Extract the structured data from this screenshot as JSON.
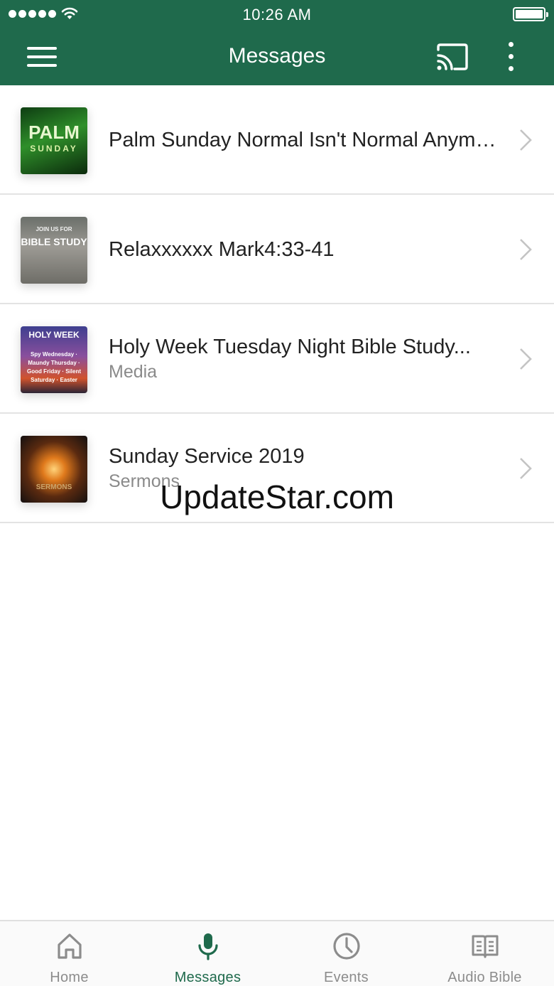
{
  "status_bar": {
    "time": "10:26 AM"
  },
  "header": {
    "title": "Messages"
  },
  "messages": [
    {
      "title": "Palm Sunday Normal Isn't Normal Anymore",
      "subtitle": "",
      "thumb_text": "PALM",
      "thumb_sub": "SUNDAY"
    },
    {
      "title": "Relaxxxxxx  Mark4:33-41",
      "subtitle": "",
      "thumb_text": "BIBLE STUDY",
      "thumb_sub": "JOIN US FOR"
    },
    {
      "title": "Holy Week Tuesday Night Bible Study...",
      "subtitle": "Media",
      "thumb_text": "HOLY WEEK",
      "thumb_sub": "Spy Wednesday · Maundy Thursday · Good Friday · Silent Saturday · Easter"
    },
    {
      "title": "Sunday Service 2019",
      "subtitle": "Sermons",
      "thumb_text": "SERMONS",
      "thumb_sub": ""
    }
  ],
  "watermark": "UpdateStar.com",
  "tabs": [
    {
      "label": "Home",
      "icon": "home-icon",
      "active": false
    },
    {
      "label": "Messages",
      "icon": "microphone-icon",
      "active": true
    },
    {
      "label": "Events",
      "icon": "clock-icon",
      "active": false
    },
    {
      "label": "Audio Bible",
      "icon": "book-icon",
      "active": false
    }
  ],
  "colors": {
    "brand": "#1f6a4c",
    "inactive_tab": "#8c8c8c",
    "divider": "#e3e3e3"
  }
}
